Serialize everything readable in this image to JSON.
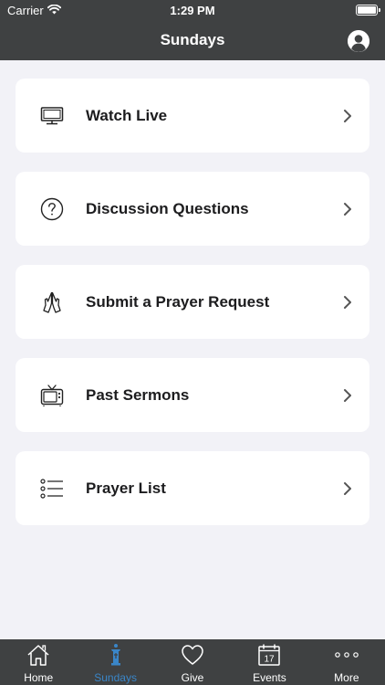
{
  "status_bar": {
    "carrier": "Carrier",
    "time": "1:29 PM"
  },
  "nav": {
    "title": "Sundays"
  },
  "cards": [
    {
      "label": "Watch Live",
      "icon": "monitor-icon"
    },
    {
      "label": "Discussion Questions",
      "icon": "question-circle-icon"
    },
    {
      "label": "Submit a Prayer Request",
      "icon": "praying-hands-icon"
    },
    {
      "label": "Past Sermons",
      "icon": "tv-icon"
    },
    {
      "label": "Prayer List",
      "icon": "list-icon"
    }
  ],
  "tabs": [
    {
      "label": "Home",
      "icon": "home-icon",
      "active": false
    },
    {
      "label": "Sundays",
      "icon": "pulpit-icon",
      "active": true
    },
    {
      "label": "Give",
      "icon": "heart-icon",
      "active": false
    },
    {
      "label": "Events",
      "icon": "calendar-icon",
      "active": false,
      "badge_text": "17"
    },
    {
      "label": "More",
      "icon": "more-dots-icon",
      "active": false
    }
  ],
  "colors": {
    "header_bg": "#3f4142",
    "page_bg": "#f2f2f7",
    "active_tab": "#3a86c8"
  }
}
